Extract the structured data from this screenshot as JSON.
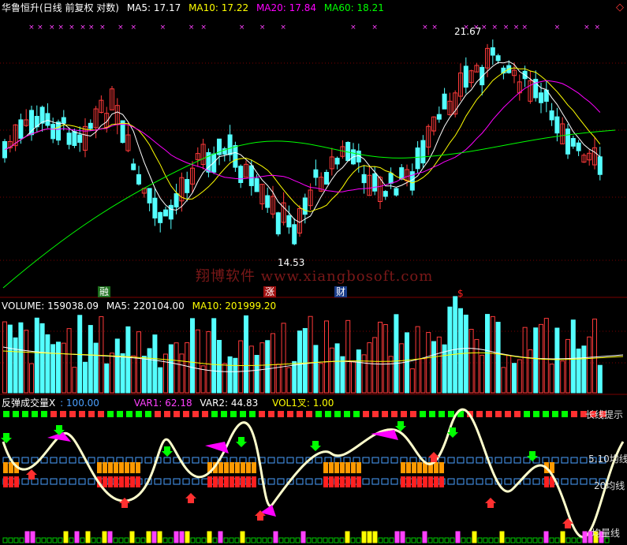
{
  "colors": {
    "up": "#ff3a3a",
    "down": "#54ffff",
    "ma5": "#ffffff",
    "ma10": "#ffff00",
    "ma20": "#ff00ff",
    "ma60": "#00ff00",
    "grid": "#7a0000",
    "magenta_mark": "#ff40ff"
  },
  "price_panel": {
    "title": "华鲁恒升(日线 前复权 对数)",
    "ma5_label": "MA5: 17.17",
    "ma10_label": "MA10: 17.22",
    "ma20_label": "MA20: 17.84",
    "ma60_label": "MA60: 18.21",
    "high_label": "21.67",
    "low_label": "14.53",
    "watermark": "翔博软件 www.xiangbosoft.com",
    "marker_icon": "diamond-icon",
    "badges": [
      {
        "text": "融",
        "color": "#ffffff",
        "bg": "#1c6f1c"
      },
      {
        "text": "涨",
        "color": "#ffffff",
        "bg": "#a01010"
      },
      {
        "text": "财",
        "color": "#ffffff",
        "bg": "#1a3c8a"
      },
      {
        "text": "$",
        "color": "#ff2020",
        "bg": ""
      }
    ]
  },
  "volume_panel": {
    "volume_label": "VOLUME: 159038.09",
    "ma5_label": "MA5: 220104.00",
    "ma10_label": "MA10: 201999.20"
  },
  "indicator_panel": {
    "name": "反弹成交量X",
    "param": ": 100.00",
    "var1": "VAR1: 62.18",
    "var2": "VAR2: 44.83",
    "vol1": "VOL1叉: 1.00",
    "right_top": "长线提示",
    "line1": "5.10均线",
    "line2": "20均线",
    "line3": "均量线"
  }
}
